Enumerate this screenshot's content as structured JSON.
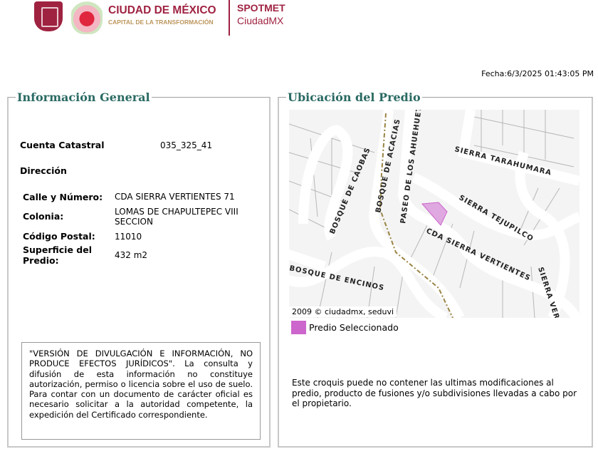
{
  "header": {
    "brand_title": "CIUDAD DE MÉXICO",
    "brand_subtitle": "CAPITAL DE LA TRANSFORMACIÓN",
    "app_title": "SPOTMET",
    "app_subtitle": "CiudadMX"
  },
  "fecha": "Fecha:6/3/2025 01:43:05 PM",
  "info": {
    "title": "Información General",
    "cuenta_label": "Cuenta Catastral",
    "cuenta_value": "035_325_41",
    "direccion_label": "Dirección",
    "calle_label": "Calle y Número:",
    "calle_value": "CDA SIERRA VERTIENTES 71",
    "colonia_label": "Colonia:",
    "colonia_value": "LOMAS DE CHAPULTEPEC VIII SECCION",
    "cp_label": "Código Postal:",
    "cp_value": "11010",
    "superficie_label": "Superficie del Predio:",
    "superficie_value": "432 m2",
    "disclaimer": "\"VERSIÓN DE DIVULGACIÓN E INFORMACIÓN, NO PRODUCE EFECTOS JURÍDICOS\". La consulta y difusión de esta información no constituye autorización, permiso o licencia sobre el uso de suelo. Para contar con un documento de carácter oficial es necesario solicitar a la autoridad competente, la expedición del Certificado correspondiente."
  },
  "ubicacion": {
    "title": "Ubicación del Predio",
    "streets": [
      "SIERRA TARAHUMARA",
      "BOSQUE DE ACACIAS",
      "PASEO DE LOS AHUEHUETE",
      "BOSQUE DE CAOBAS",
      "SIERRA TEJUPILCO",
      "CDA SIERRA VERTIENTES",
      "BOSQUE DE ENCINOS",
      "SIERRA VERT"
    ],
    "copyright": "2009 © ciudadmx, seduvi",
    "legend": "Predio Seleccionado",
    "legend_color": "#cc66cc",
    "note": "Este croquis puede no contener las ultimas modificaciones al predio, producto de fusiones y/o subdivisiones llevadas a cabo por el propietario."
  }
}
